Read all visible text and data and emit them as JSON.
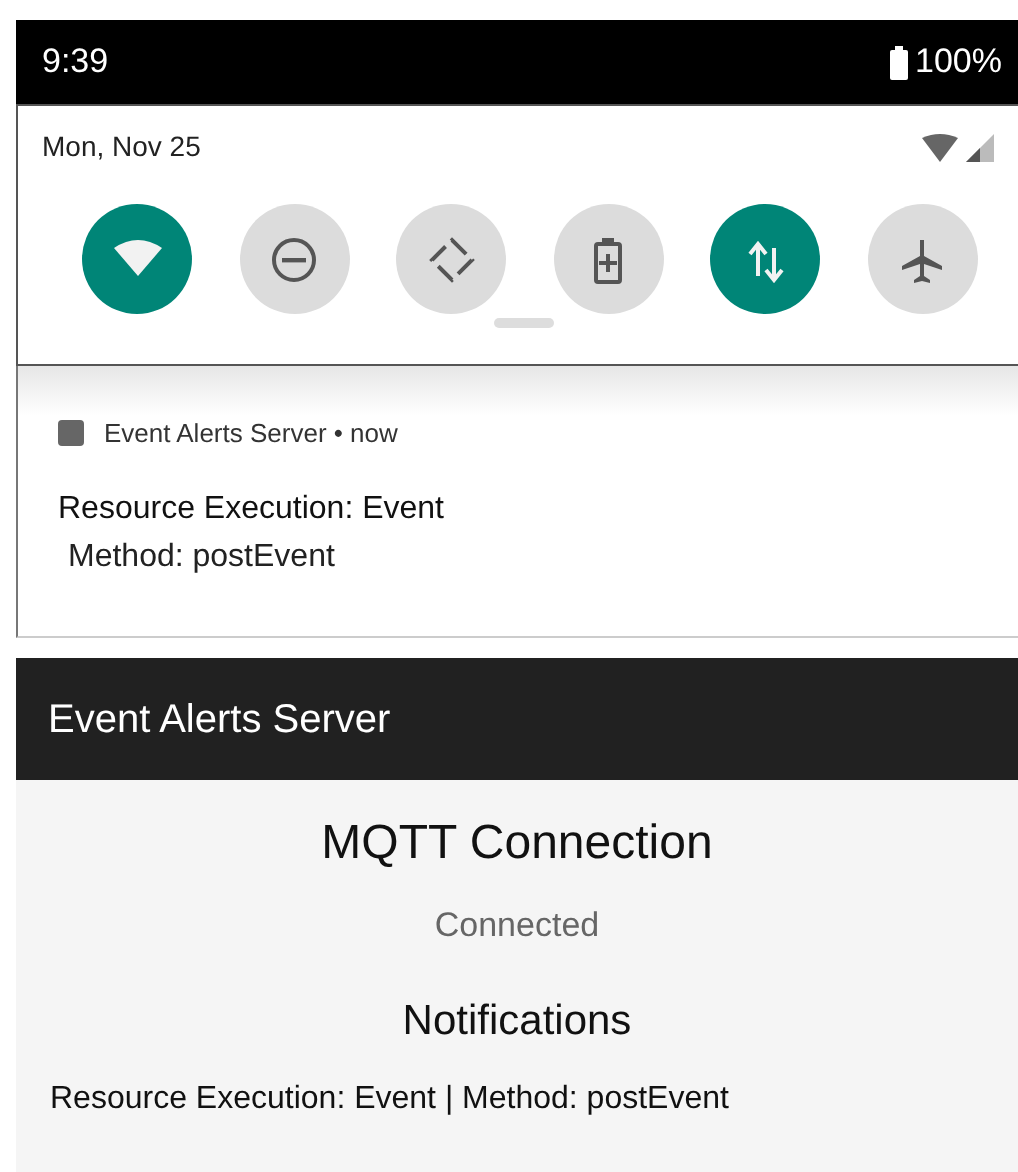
{
  "status_bar": {
    "time": "9:39",
    "battery": "100%"
  },
  "quick_settings": {
    "date": "Mon, Nov 25",
    "tiles": [
      {
        "kind": "wifi",
        "on": true
      },
      {
        "kind": "dnd",
        "on": false
      },
      {
        "kind": "rotate",
        "on": false
      },
      {
        "kind": "saver",
        "on": false
      },
      {
        "kind": "data",
        "on": true
      },
      {
        "kind": "airplane",
        "on": false
      }
    ]
  },
  "notification": {
    "app": "Event Alerts Server",
    "separator": "•",
    "time": "now",
    "title": "Resource Execution: Event",
    "body": "Method: postEvent"
  },
  "app_bar": {
    "title": "Event Alerts Server"
  },
  "content": {
    "connection_heading": "MQTT Connection",
    "connection_status": "Connected",
    "notifications_heading": "Notifications",
    "notifications": [
      "Resource Execution: Event | Method: postEvent"
    ]
  }
}
